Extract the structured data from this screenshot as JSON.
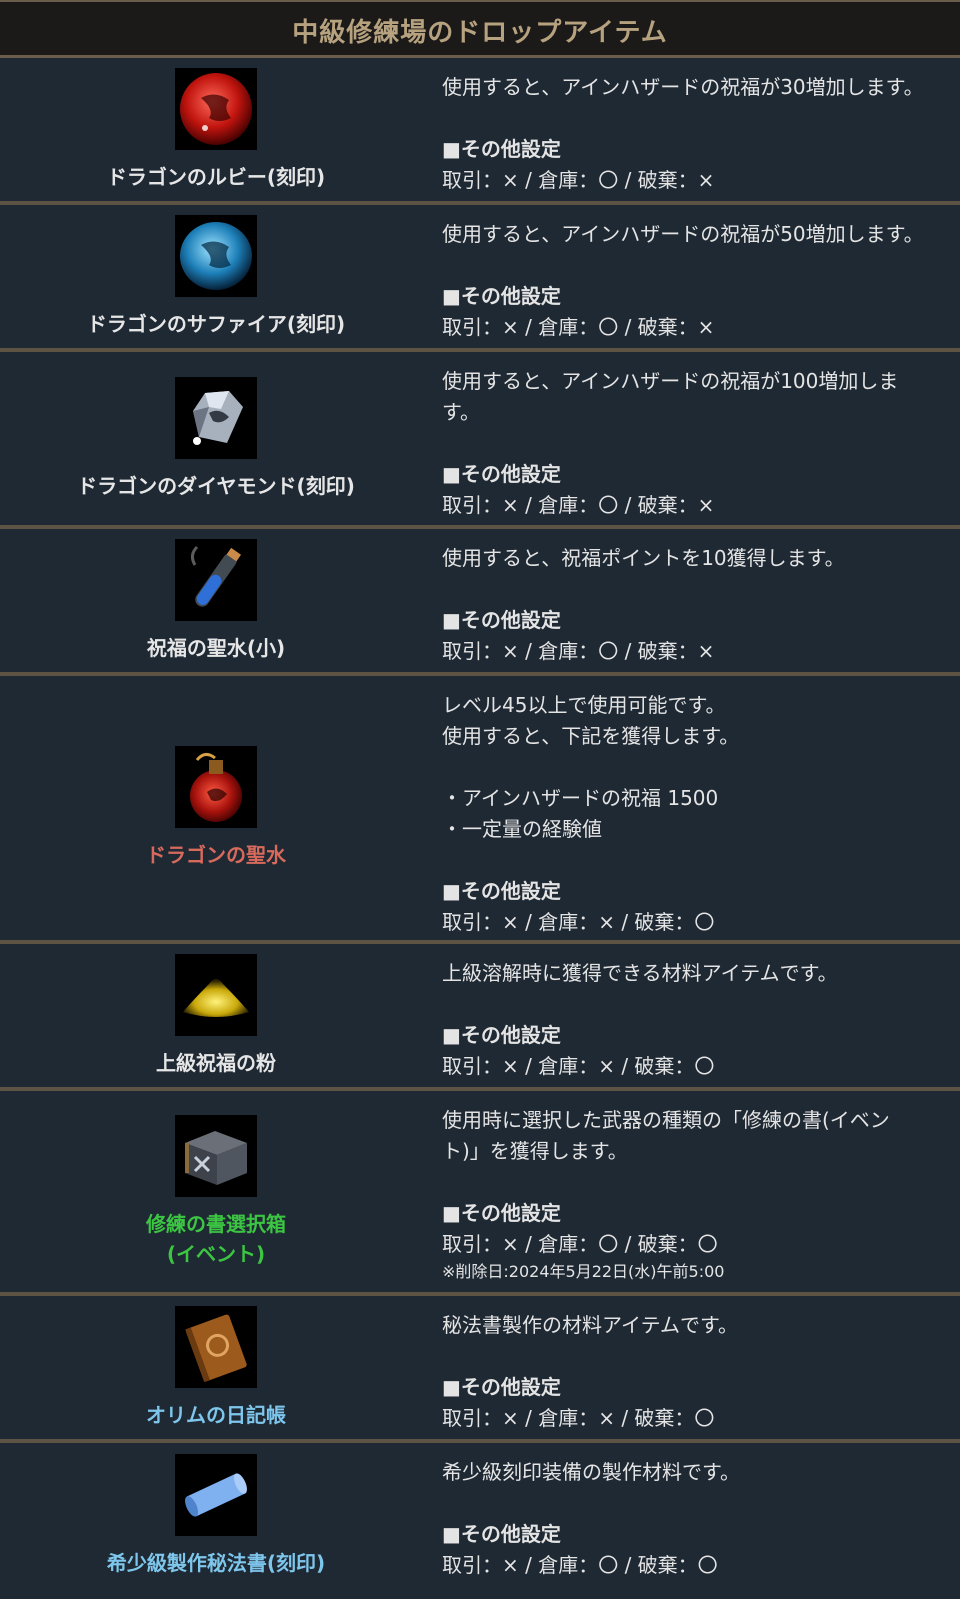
{
  "title": "中級修練場のドロップアイテム",
  "settings_label": "■その他設定",
  "colors": {
    "normal": "#e6e6e6",
    "rare_red": "#d86a5c",
    "green": "#3cc542",
    "blue": "#7ec6ec",
    "title": "#b7a27f"
  },
  "items": [
    {
      "icon": "dragon-ruby-icon",
      "name": "ドラゴンのルビー(刻印)",
      "desc": [
        "使用すると、アインハザードの祝福が30増加します。"
      ],
      "trade": "取引：× / 倉庫：〇 / 破棄：×"
    },
    {
      "icon": "dragon-sapphire-icon",
      "name": "ドラゴンのサファイア(刻印)",
      "desc": [
        "使用すると、アインハザードの祝福が50増加します。"
      ],
      "trade": "取引：× / 倉庫：〇 / 破棄：×"
    },
    {
      "icon": "dragon-diamond-icon",
      "name": "ドラゴンのダイヤモンド(刻印)",
      "desc": [
        "使用すると、アインハザードの祝福が100増加しま",
        "す。"
      ],
      "trade": "取引：× / 倉庫：〇 / 破棄：×"
    },
    {
      "icon": "holy-water-small-icon",
      "name": "祝福の聖水(小)",
      "desc": [
        "使用すると、祝福ポイントを10獲得します。"
      ],
      "trade": "取引：× / 倉庫：〇 / 破棄：×"
    },
    {
      "icon": "dragon-holy-water-icon",
      "name": "ドラゴンの聖水",
      "desc": [
        "レベル45以上で使用可能です。",
        "使用すると、下記を獲得します。",
        "",
        "・アインハザードの祝福 1500",
        "・一定量の経験値"
      ],
      "trade": "取引：× / 倉庫：× / 破棄：〇"
    },
    {
      "icon": "blessing-powder-icon",
      "name": "上級祝福の粉",
      "desc": [
        "上級溶解時に獲得できる材料アイテムです。"
      ],
      "trade": "取引：× / 倉庫：× / 破棄：〇"
    },
    {
      "icon": "training-book-box-icon",
      "name": "修練の書選択箱",
      "name2": "(イベント)",
      "desc": [
        "使用時に選択した武器の種類の「修練の書(イベン",
        "ト)」を獲得します。"
      ],
      "trade": "取引：× / 倉庫：〇 / 破棄：〇",
      "note": "※削除日:2024年5月22日(水)午前5:00"
    },
    {
      "icon": "orim-diary-icon",
      "name": "オリムの日記帳",
      "desc": [
        "秘法書製作の材料アイテムです。"
      ],
      "trade": "取引：× / 倉庫：× / 破棄：〇"
    },
    {
      "icon": "scroll-icon",
      "name": "希少級製作秘法書(刻印)",
      "desc": [
        "希少級刻印装備の製作材料です。"
      ],
      "trade": "取引：× / 倉庫：〇 / 破棄：〇"
    }
  ]
}
